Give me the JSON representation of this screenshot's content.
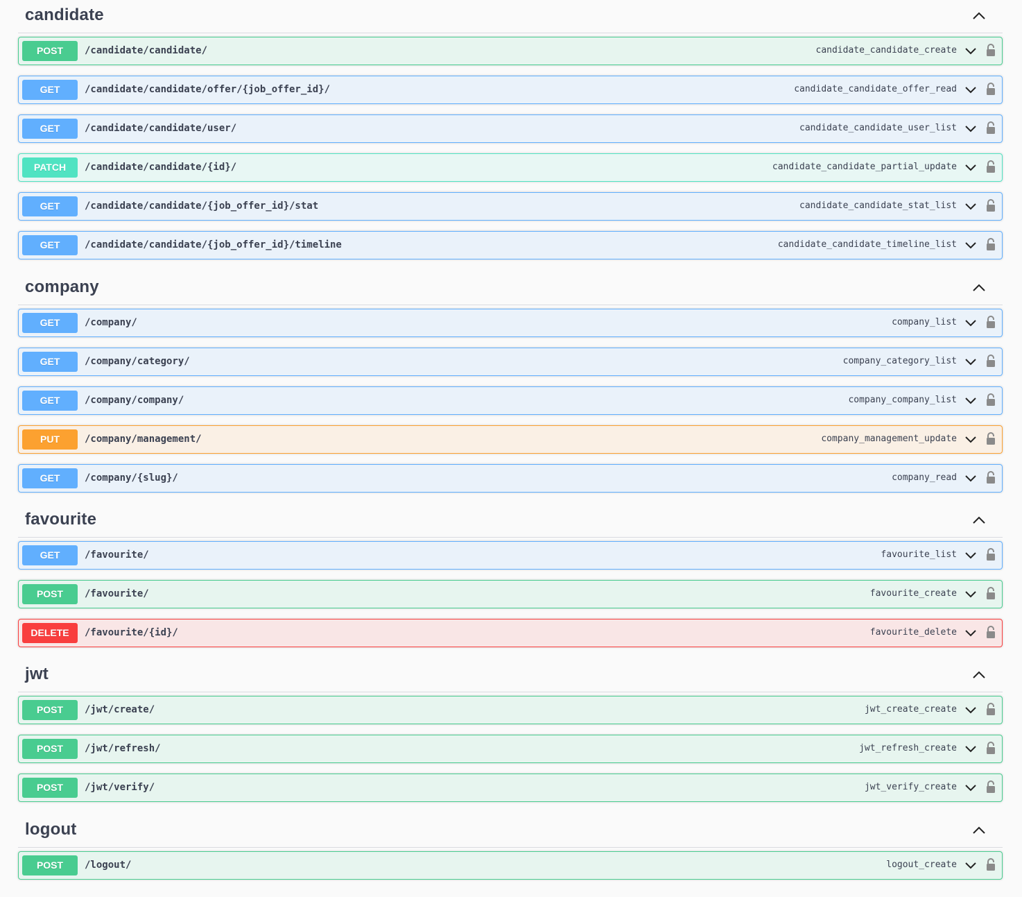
{
  "sections": [
    {
      "name": "candidate",
      "operations": [
        {
          "method": "POST",
          "path": "/candidate/candidate/",
          "operation_id": "candidate_candidate_create"
        },
        {
          "method": "GET",
          "path": "/candidate/candidate/offer/{job_offer_id}/",
          "operation_id": "candidate_candidate_offer_read"
        },
        {
          "method": "GET",
          "path": "/candidate/candidate/user/",
          "operation_id": "candidate_candidate_user_list"
        },
        {
          "method": "PATCH",
          "path": "/candidate/candidate/{id}/",
          "operation_id": "candidate_candidate_partial_update"
        },
        {
          "method": "GET",
          "path": "/candidate/candidate/{job_offer_id}/stat",
          "operation_id": "candidate_candidate_stat_list"
        },
        {
          "method": "GET",
          "path": "/candidate/candidate/{job_offer_id}/timeline",
          "operation_id": "candidate_candidate_timeline_list"
        }
      ]
    },
    {
      "name": "company",
      "operations": [
        {
          "method": "GET",
          "path": "/company/",
          "operation_id": "company_list"
        },
        {
          "method": "GET",
          "path": "/company/category/",
          "operation_id": "company_category_list"
        },
        {
          "method": "GET",
          "path": "/company/company/",
          "operation_id": "company_company_list"
        },
        {
          "method": "PUT",
          "path": "/company/management/",
          "operation_id": "company_management_update"
        },
        {
          "method": "GET",
          "path": "/company/{slug}/",
          "operation_id": "company_read"
        }
      ]
    },
    {
      "name": "favourite",
      "operations": [
        {
          "method": "GET",
          "path": "/favourite/",
          "operation_id": "favourite_list"
        },
        {
          "method": "POST",
          "path": "/favourite/",
          "operation_id": "favourite_create"
        },
        {
          "method": "DELETE",
          "path": "/favourite/{id}/",
          "operation_id": "favourite_delete"
        }
      ]
    },
    {
      "name": "jwt",
      "operations": [
        {
          "method": "POST",
          "path": "/jwt/create/",
          "operation_id": "jwt_create_create"
        },
        {
          "method": "POST",
          "path": "/jwt/refresh/",
          "operation_id": "jwt_refresh_create"
        },
        {
          "method": "POST",
          "path": "/jwt/verify/",
          "operation_id": "jwt_verify_create"
        }
      ]
    },
    {
      "name": "logout",
      "operations": [
        {
          "method": "POST",
          "path": "/logout/",
          "operation_id": "logout_create"
        }
      ]
    }
  ],
  "method_colors": {
    "POST": "#49cc90",
    "GET": "#61affe",
    "PUT": "#fca130",
    "PATCH": "#50e3c2",
    "DELETE": "#f93e3e"
  },
  "icons": {
    "section_toggle": "chevron-up-icon",
    "operation_toggle": "chevron-down-icon",
    "authorization": "lock-icon"
  }
}
